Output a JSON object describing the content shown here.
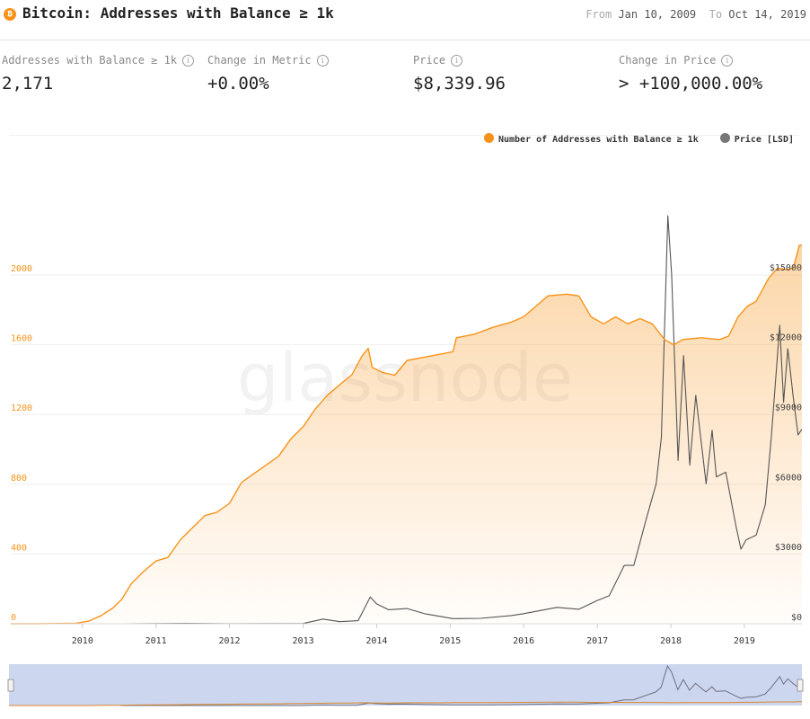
{
  "header": {
    "logo_glyph": "₿",
    "title": "Bitcoin: Addresses with Balance ≥ 1k",
    "from_label": "From",
    "from_date": "Jan 10, 2009",
    "to_label": "To",
    "to_date": "Oct 14, 2019"
  },
  "metrics": [
    {
      "label": "Addresses with Balance ≥ 1k",
      "value": "2,171"
    },
    {
      "label": "Change in Metric",
      "value": "+0.00%"
    },
    {
      "label": "Price",
      "value": "$8,339.96"
    },
    {
      "label": "Change in Price",
      "value": "> +100,000.00%"
    }
  ],
  "info_glyph": "i",
  "watermark": "glassnode",
  "legend": [
    {
      "name": "Number of Addresses with Balance ≥ 1k",
      "color": "#f7931a"
    },
    {
      "name": "Price [LSD]",
      "color": "#777777"
    }
  ],
  "colors": {
    "accent": "#f7931a",
    "price": "#555555",
    "navigator_bg": "#cdd6ef"
  },
  "chart_data": {
    "type": "line",
    "title": "",
    "xlabel": "",
    "x_range": [
      "2009-01-10",
      "2019-10-14"
    ],
    "x_ticks": [
      "2010",
      "2011",
      "2012",
      "2013",
      "2014",
      "2015",
      "2016",
      "2017",
      "2018",
      "2019"
    ],
    "y_left_ticks": [
      "0",
      "400",
      "800",
      "1200",
      "1600",
      "2000"
    ],
    "y_left_range": [
      0,
      2340
    ],
    "y_right_ticks": [
      "$0",
      "$3000",
      "$6000",
      "$9000",
      "$12000",
      "$15000"
    ],
    "y_right_range": [
      0,
      17500
    ],
    "grid": true,
    "legend_position": "top-right",
    "series": [
      {
        "name": "Number of Addresses with Balance ≥ 1k",
        "axis": "left",
        "color": "#f7931a",
        "fill": "area-gradient",
        "points": [
          [
            "2009-01-10",
            0
          ],
          [
            "2009-06-01",
            0
          ],
          [
            "2009-12-01",
            3
          ],
          [
            "2010-02-01",
            15
          ],
          [
            "2010-04-01",
            45
          ],
          [
            "2010-06-01",
            90
          ],
          [
            "2010-07-15",
            140
          ],
          [
            "2010-09-01",
            230
          ],
          [
            "2010-11-01",
            300
          ],
          [
            "2011-01-01",
            360
          ],
          [
            "2011-03-01",
            380
          ],
          [
            "2011-05-01",
            480
          ],
          [
            "2011-07-01",
            550
          ],
          [
            "2011-09-01",
            620
          ],
          [
            "2011-11-01",
            640
          ],
          [
            "2012-01-01",
            690
          ],
          [
            "2012-03-01",
            810
          ],
          [
            "2012-05-01",
            860
          ],
          [
            "2012-07-01",
            910
          ],
          [
            "2012-09-01",
            960
          ],
          [
            "2012-11-01",
            1060
          ],
          [
            "2013-01-01",
            1130
          ],
          [
            "2013-03-01",
            1230
          ],
          [
            "2013-05-01",
            1310
          ],
          [
            "2013-07-01",
            1370
          ],
          [
            "2013-09-01",
            1430
          ],
          [
            "2013-10-20",
            1535
          ],
          [
            "2013-11-20",
            1580
          ],
          [
            "2013-12-10",
            1470
          ],
          [
            "2014-02-01",
            1440
          ],
          [
            "2014-04-01",
            1425
          ],
          [
            "2014-06-01",
            1510
          ],
          [
            "2014-09-01",
            1530
          ],
          [
            "2014-12-01",
            1550
          ],
          [
            "2015-01-15",
            1560
          ],
          [
            "2015-02-01",
            1640
          ],
          [
            "2015-05-01",
            1660
          ],
          [
            "2015-08-01",
            1700
          ],
          [
            "2015-11-01",
            1730
          ],
          [
            "2016-01-01",
            1760
          ],
          [
            "2016-03-01",
            1820
          ],
          [
            "2016-05-01",
            1880
          ],
          [
            "2016-08-01",
            1890
          ],
          [
            "2016-10-01",
            1880
          ],
          [
            "2016-12-01",
            1760
          ],
          [
            "2017-02-01",
            1720
          ],
          [
            "2017-04-01",
            1760
          ],
          [
            "2017-06-01",
            1720
          ],
          [
            "2017-08-01",
            1750
          ],
          [
            "2017-10-01",
            1720
          ],
          [
            "2017-12-01",
            1630
          ],
          [
            "2018-01-15",
            1600
          ],
          [
            "2018-03-01",
            1630
          ],
          [
            "2018-06-01",
            1640
          ],
          [
            "2018-09-01",
            1630
          ],
          [
            "2018-10-15",
            1650
          ],
          [
            "2018-12-01",
            1760
          ],
          [
            "2019-01-15",
            1820
          ],
          [
            "2019-03-01",
            1850
          ],
          [
            "2019-05-01",
            1980
          ],
          [
            "2019-06-15",
            2040
          ],
          [
            "2019-08-01",
            2030
          ],
          [
            "2019-09-01",
            2040
          ],
          [
            "2019-10-01",
            2170
          ],
          [
            "2019-10-14",
            2171
          ]
        ]
      },
      {
        "name": "Price [LSD]",
        "axis": "right",
        "color": "#555555",
        "points": [
          [
            "2010-07-18",
            0.1
          ],
          [
            "2011-06-01",
            15
          ],
          [
            "2012-01-01",
            5
          ],
          [
            "2013-01-01",
            13
          ],
          [
            "2013-04-10",
            200
          ],
          [
            "2013-07-01",
            90
          ],
          [
            "2013-10-01",
            130
          ],
          [
            "2013-11-30",
            1150
          ],
          [
            "2014-01-01",
            850
          ],
          [
            "2014-03-01",
            600
          ],
          [
            "2014-06-01",
            650
          ],
          [
            "2014-09-01",
            420
          ],
          [
            "2015-01-15",
            220
          ],
          [
            "2015-06-01",
            230
          ],
          [
            "2015-11-01",
            350
          ],
          [
            "2016-01-01",
            430
          ],
          [
            "2016-06-15",
            700
          ],
          [
            "2016-10-01",
            620
          ],
          [
            "2017-01-01",
            1000
          ],
          [
            "2017-03-01",
            1200
          ],
          [
            "2017-05-15",
            2500
          ],
          [
            "2017-07-01",
            2500
          ],
          [
            "2017-09-01",
            4500
          ],
          [
            "2017-10-20",
            6000
          ],
          [
            "2017-11-15",
            8000
          ],
          [
            "2017-12-17",
            19000
          ],
          [
            "2018-01-05",
            15000
          ],
          [
            "2018-02-06",
            7000
          ],
          [
            "2018-03-05",
            11500
          ],
          [
            "2018-04-05",
            6800
          ],
          [
            "2018-05-05",
            9800
          ],
          [
            "2018-06-25",
            6000
          ],
          [
            "2018-07-25",
            8300
          ],
          [
            "2018-08-15",
            6300
          ],
          [
            "2018-10-01",
            6500
          ],
          [
            "2018-11-20",
            4200
          ],
          [
            "2018-12-15",
            3200
          ],
          [
            "2019-01-10",
            3600
          ],
          [
            "2019-03-01",
            3800
          ],
          [
            "2019-04-15",
            5100
          ],
          [
            "2019-05-15",
            8000
          ],
          [
            "2019-06-26",
            12800
          ],
          [
            "2019-07-15",
            9500
          ],
          [
            "2019-08-05",
            11800
          ],
          [
            "2019-09-01",
            9700
          ],
          [
            "2019-09-25",
            8100
          ],
          [
            "2019-10-14",
            8340
          ]
        ]
      }
    ]
  }
}
